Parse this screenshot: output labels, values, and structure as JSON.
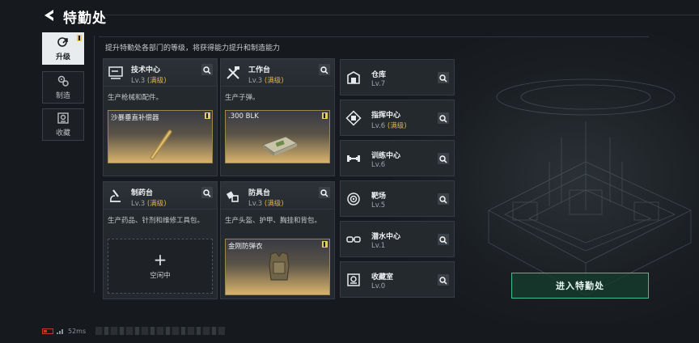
{
  "header": {
    "title": "特勤处"
  },
  "subtitle": "提升特勤处各部门的等级，将获得能力提升和制造能力",
  "tabs": [
    {
      "label": "升级",
      "icon": "upgrade-icon",
      "active": true
    },
    {
      "label": "制造",
      "icon": "gears-icon",
      "active": false
    },
    {
      "label": "收藏",
      "icon": "collection-icon",
      "active": false
    }
  ],
  "workshops": [
    {
      "name": "技术中心",
      "level": "Lv.3",
      "level_tag": "(满级)",
      "desc": "生产枪械和配件。",
      "slot_item": "沙暴垂直补偿器",
      "icon": "computer-icon"
    },
    {
      "name": "工作台",
      "level": "Lv.3",
      "level_tag": "(满级)",
      "desc": "生产子弹。",
      "slot_item": ".300 BLK",
      "icon": "tools-icon"
    },
    {
      "name": "制药台",
      "level": "Lv.3",
      "level_tag": "(满级)",
      "desc": "生产药品、针剂和维修工具包。",
      "slot_empty": "空闲中",
      "icon": "microscope-icon"
    },
    {
      "name": "防具台",
      "level": "Lv.3",
      "level_tag": "(满级)",
      "desc": "生产头盔、护甲、胸挂和背包。",
      "slot_item": "金刚防弹衣",
      "icon": "armor-icon"
    }
  ],
  "facilities": [
    {
      "name": "仓库",
      "level": "Lv.7",
      "level_tag": "",
      "icon": "warehouse-icon"
    },
    {
      "name": "指挥中心",
      "level": "Lv.6",
      "level_tag": "(满级)",
      "icon": "command-icon"
    },
    {
      "name": "训练中心",
      "level": "Lv.6",
      "level_tag": "",
      "icon": "dumbbell-icon"
    },
    {
      "name": "靶场",
      "level": "Lv.5",
      "level_tag": "",
      "icon": "target-icon"
    },
    {
      "name": "潜水中心",
      "level": "Lv.1",
      "level_tag": "",
      "icon": "goggles-icon"
    },
    {
      "name": "收藏室",
      "level": "Lv.0",
      "level_tag": "",
      "icon": "vault-icon"
    }
  ],
  "enter_button": "进入特勤处",
  "status": {
    "ping": "52ms"
  },
  "colors": {
    "accent_green": "#3fbf8e",
    "max_gold": "#d9b64a",
    "badge_yellow": "#e6c96a"
  }
}
